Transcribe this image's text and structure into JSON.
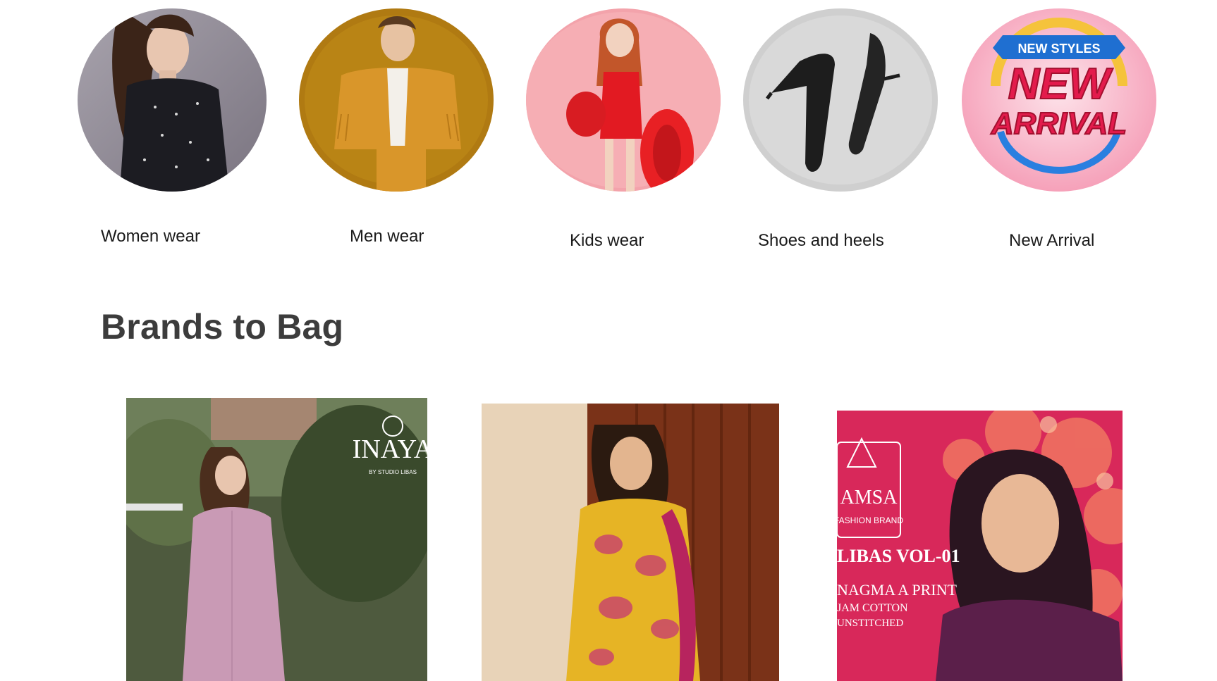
{
  "categories": [
    {
      "label": "Women wear",
      "image": "woman-in-black-dress-photo"
    },
    {
      "label": "Men wear",
      "image": "man-in-mustard-fringe-jacket-photo"
    },
    {
      "label": "Kids wear",
      "image": "girl-in-red-swimsuit-photo"
    },
    {
      "label": "Shoes and heels",
      "image": "black-stiletto-heels-photo"
    },
    {
      "label": "New Arrival",
      "image": "new-arrival-badge"
    }
  ],
  "new_arrival_badge": {
    "ribbon_text": "NEW STYLES",
    "line1": "NEW",
    "line2": "ARRIVAL"
  },
  "section": {
    "title": "Brands to Bag"
  },
  "brands": [
    {
      "image": "inaya-pink-kurti-photo",
      "logo_text": "INAYA",
      "logo_sub": "BY STUDIO LIBAS"
    },
    {
      "image": "yellow-floral-suit-photo"
    },
    {
      "image": "amsa-lawn-suit-photo",
      "logo_text": "AMSA",
      "logo_sub": "FASHION BRAND",
      "title": "LIBAS VOL-01",
      "line1": "NAGMA A PRINT",
      "line2": "JAM COTTON",
      "line3": "UNSTITCHED"
    }
  ],
  "colors": {
    "title": "#3c3c3c",
    "label": "#1a1a1a",
    "badge_red": "#e31b4c",
    "badge_blue": "#1f6fd1"
  }
}
